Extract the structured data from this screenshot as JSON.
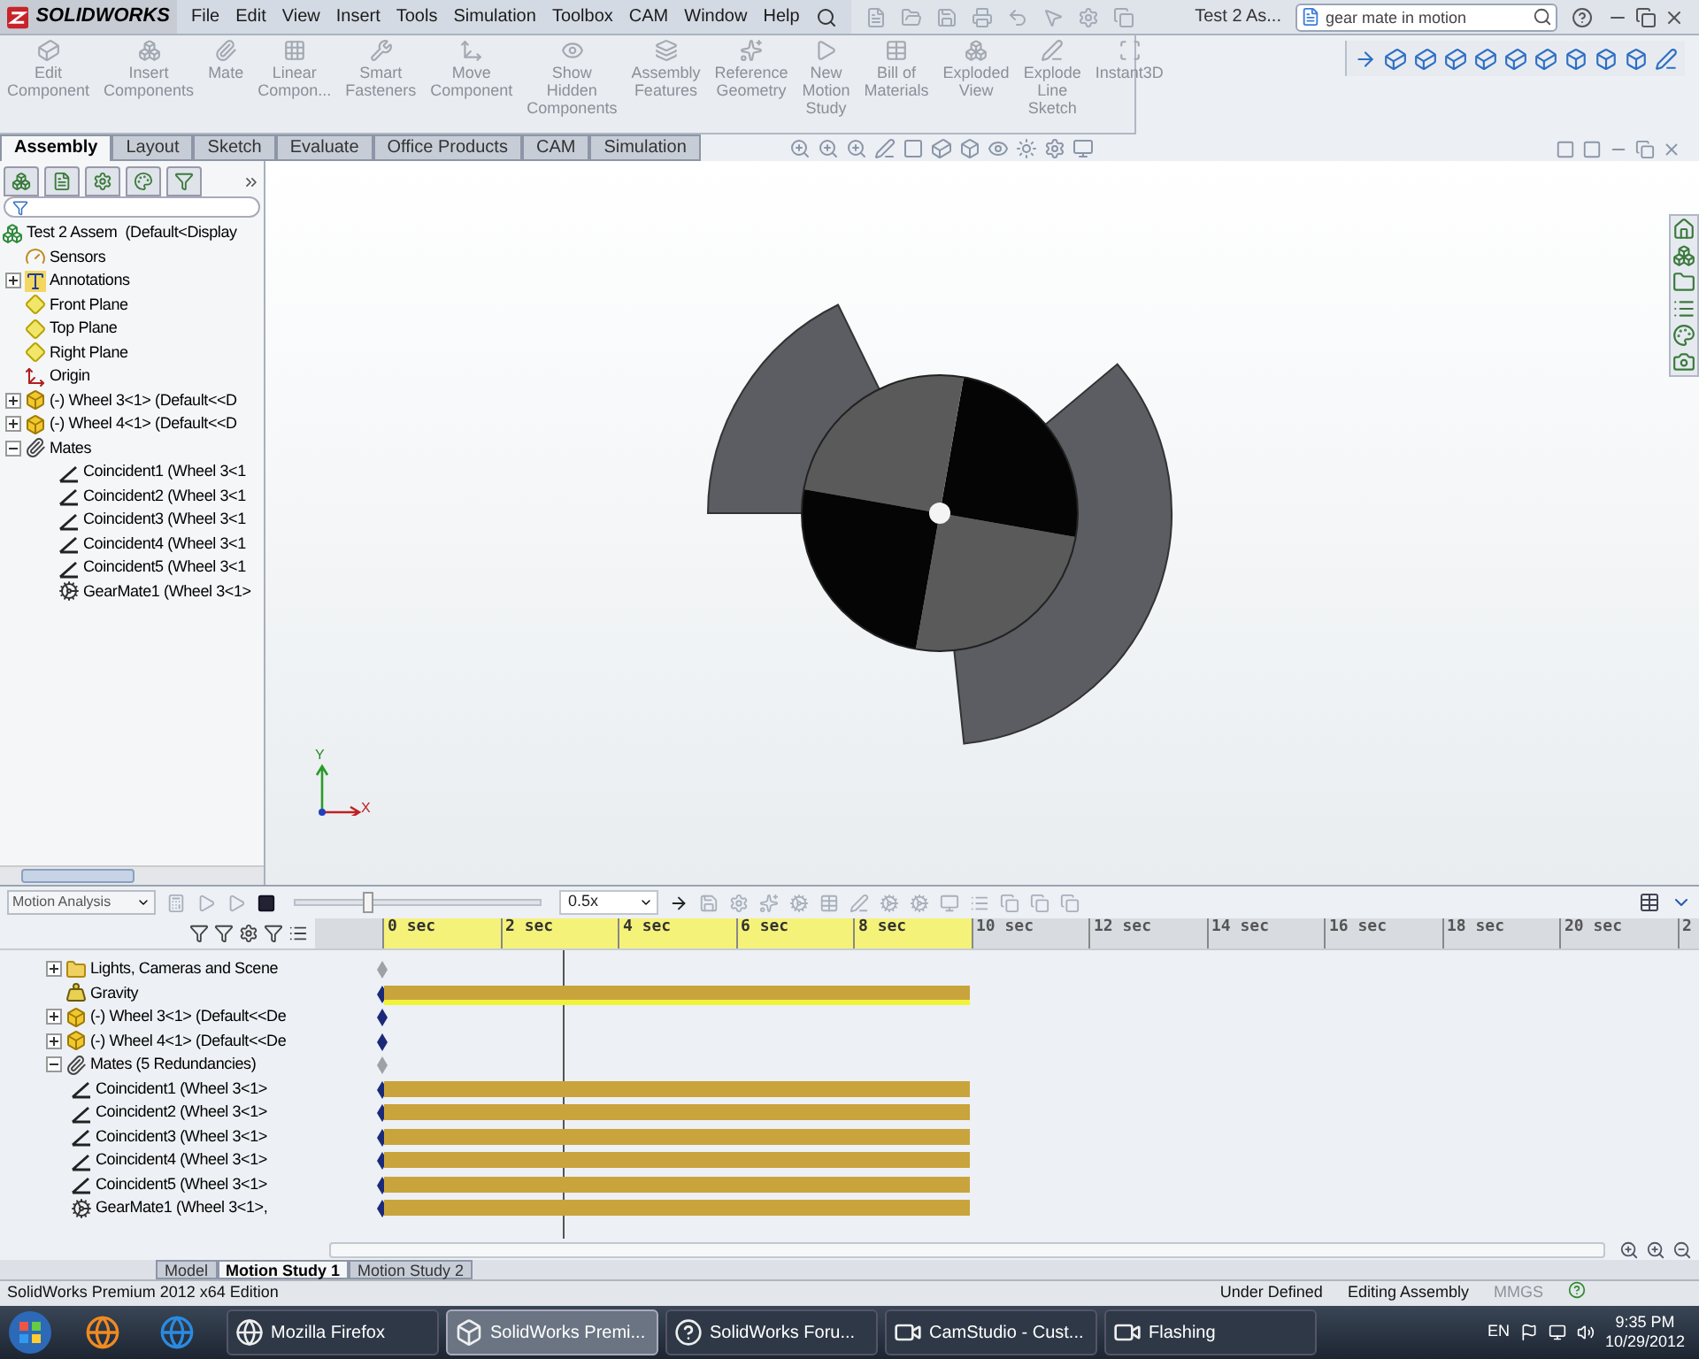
{
  "title_bar": {
    "logo": "SOLIDWORKS",
    "menus": [
      "File",
      "Edit",
      "View",
      "Insert",
      "Tools",
      "Simulation",
      "Toolbox",
      "CAM",
      "Window",
      "Help"
    ],
    "document_title": "Test 2 As...",
    "search": {
      "value": "gear mate in motion"
    }
  },
  "command_manager": {
    "buttons": [
      {
        "label": "Edit\nComponent",
        "kind": "edit"
      },
      {
        "label": "Insert\nComponents",
        "kind": "insert"
      },
      {
        "label": "Mate",
        "kind": "mate"
      },
      {
        "label": "Linear\nCompon...",
        "kind": "pattern"
      },
      {
        "label": "Smart\nFasteners",
        "kind": "fastener"
      },
      {
        "label": "Move\nComponent",
        "kind": "move"
      },
      {
        "label": "Show\nHidden\nComponents",
        "kind": "show"
      },
      {
        "label": "Assembly\nFeatures",
        "kind": "features"
      },
      {
        "label": "Reference\nGeometry",
        "kind": "geometry"
      },
      {
        "label": "New\nMotion\nStudy",
        "kind": "motion"
      },
      {
        "label": "Bill of\nMaterials",
        "kind": "bom"
      },
      {
        "label": "Exploded\nView",
        "kind": "explode"
      },
      {
        "label": "Explode\nLine\nSketch",
        "kind": "line"
      },
      {
        "label": "Instant3D",
        "kind": "instant"
      }
    ],
    "tabs": [
      {
        "label": "Assembly",
        "selected": true
      },
      {
        "label": "Layout",
        "selected": false
      },
      {
        "label": "Sketch",
        "selected": false
      },
      {
        "label": "Evaluate",
        "selected": false
      },
      {
        "label": "Office Products",
        "selected": false
      },
      {
        "label": "CAM",
        "selected": false
      },
      {
        "label": "Simulation",
        "selected": false
      }
    ]
  },
  "feature_tree": {
    "items": [
      {
        "label": "Test 2 Assem  (Default<Display",
        "kind": "assembly",
        "children": [
          {
            "label": "Sensors",
            "kind": "sensor"
          },
          {
            "label": "Annotations",
            "kind": "annotation",
            "expanded": false
          },
          {
            "label": "Front Plane",
            "kind": "plane"
          },
          {
            "label": "Top Plane",
            "kind": "plane"
          },
          {
            "label": "Right Plane",
            "kind": "plane"
          },
          {
            "label": "Origin",
            "kind": "origin"
          },
          {
            "label": "(-) Wheel 3<1> (Default<<D",
            "kind": "part",
            "expanded": false
          },
          {
            "label": "(-) Wheel 4<1> (Default<<D",
            "kind": "part",
            "expanded": false
          },
          {
            "label": "Mates",
            "kind": "mates",
            "expanded": true,
            "children": [
              {
                "label": "Coincident1 (Wheel 3<1",
                "kind": "mate"
              },
              {
                "label": "Coincident2 (Wheel 3<1",
                "kind": "mate"
              },
              {
                "label": "Coincident3 (Wheel 3<1",
                "kind": "mate"
              },
              {
                "label": "Coincident4 (Wheel 3<1",
                "kind": "mate"
              },
              {
                "label": "Coincident5 (Wheel 3<1",
                "kind": "mate"
              },
              {
                "label": "GearMate1 (Wheel 3<1>",
                "kind": "gearmate"
              }
            ]
          }
        ]
      }
    ]
  },
  "viewport": {
    "triad": {
      "x": "X",
      "y": "Y"
    }
  },
  "motion_study": {
    "study_type": "Motion Analysis",
    "playback": {
      "level": 0.3
    },
    "speed": "0.5x",
    "ticks": [
      {
        "label": "0 sec",
        "highlighted": true
      },
      {
        "label": "2 sec",
        "highlighted": true
      },
      {
        "label": "4 sec",
        "highlighted": true
      },
      {
        "label": "6 sec",
        "highlighted": true
      },
      {
        "label": "8 sec",
        "highlighted": true
      },
      {
        "label": "10 sec",
        "highlighted": false
      },
      {
        "label": "12 sec",
        "highlighted": false
      },
      {
        "label": "14 sec",
        "highlighted": false
      },
      {
        "label": "16 sec",
        "highlighted": false
      },
      {
        "label": "18 sec",
        "highlighted": false
      },
      {
        "label": "20 sec",
        "highlighted": false
      },
      {
        "label": "2",
        "highlighted": false
      }
    ],
    "rows": [
      {
        "label": "Lights, Cameras and Scene",
        "kind": "lights",
        "expanded": false,
        "key_active": false
      },
      {
        "label": "Gravity",
        "kind": "gravity",
        "track": {
          "kind": "bar"
        },
        "key_active": true
      },
      {
        "label": "(-) Wheel 3<1> (Default<<De",
        "kind": "part",
        "expanded": false,
        "track": {
          "kind": "line"
        },
        "key_active": true
      },
      {
        "label": "(-) Wheel 4<1> (Default<<De",
        "kind": "part",
        "expanded": false,
        "key_active": true
      },
      {
        "label": "Mates (5 Redundancies)",
        "kind": "mates",
        "expanded": true,
        "key_active": false,
        "children": [
          {
            "label": "Coincident1 (Wheel 3<1>",
            "kind": "mate",
            "track": {
              "kind": "bar"
            },
            "key_active": true
          },
          {
            "label": "Coincident2 (Wheel 3<1>",
            "kind": "mate",
            "track": {
              "kind": "bar"
            },
            "key_active": true
          },
          {
            "label": "Coincident3 (Wheel 3<1>",
            "kind": "mate",
            "track": {
              "kind": "bar"
            },
            "key_active": true
          },
          {
            "label": "Coincident4 (Wheel 3<1>",
            "kind": "mate",
            "track": {
              "kind": "bar"
            },
            "key_active": true
          },
          {
            "label": "Coincident5 (Wheel 3<1>",
            "kind": "mate",
            "track": {
              "kind": "bar"
            },
            "key_active": true
          },
          {
            "label": "GearMate1 (Wheel 3<1>,",
            "kind": "gearmate",
            "track": {
              "kind": "bar"
            },
            "key_active": true
          }
        ]
      }
    ],
    "tabs": [
      {
        "label": "Model",
        "selected": false
      },
      {
        "label": "Motion Study 1",
        "selected": true
      },
      {
        "label": "Motion Study 2",
        "selected": false
      }
    ]
  },
  "status_bar": {
    "product": "SolidWorks Premium 2012 x64 Edition",
    "fields": [
      {
        "label": "Under Defined",
        "disabled": false
      },
      {
        "label": "Editing Assembly",
        "disabled": false
      },
      {
        "label": "MMGS",
        "disabled": true
      }
    ]
  },
  "taskbar": {
    "tasks": [
      {
        "label": "Mozilla Firefox",
        "kind": "browser",
        "selected": false
      },
      {
        "label": "SolidWorks Premi...",
        "kind": "cad",
        "selected": true
      },
      {
        "label": "SolidWorks Foru...",
        "kind": "help",
        "selected": false
      },
      {
        "label": "CamStudio - Cust...",
        "kind": "video",
        "selected": false
      },
      {
        "label": "Flashing",
        "kind": "video",
        "selected": false
      }
    ],
    "language": "EN",
    "time": "9:35 PM",
    "date": "10/29/2012"
  }
}
